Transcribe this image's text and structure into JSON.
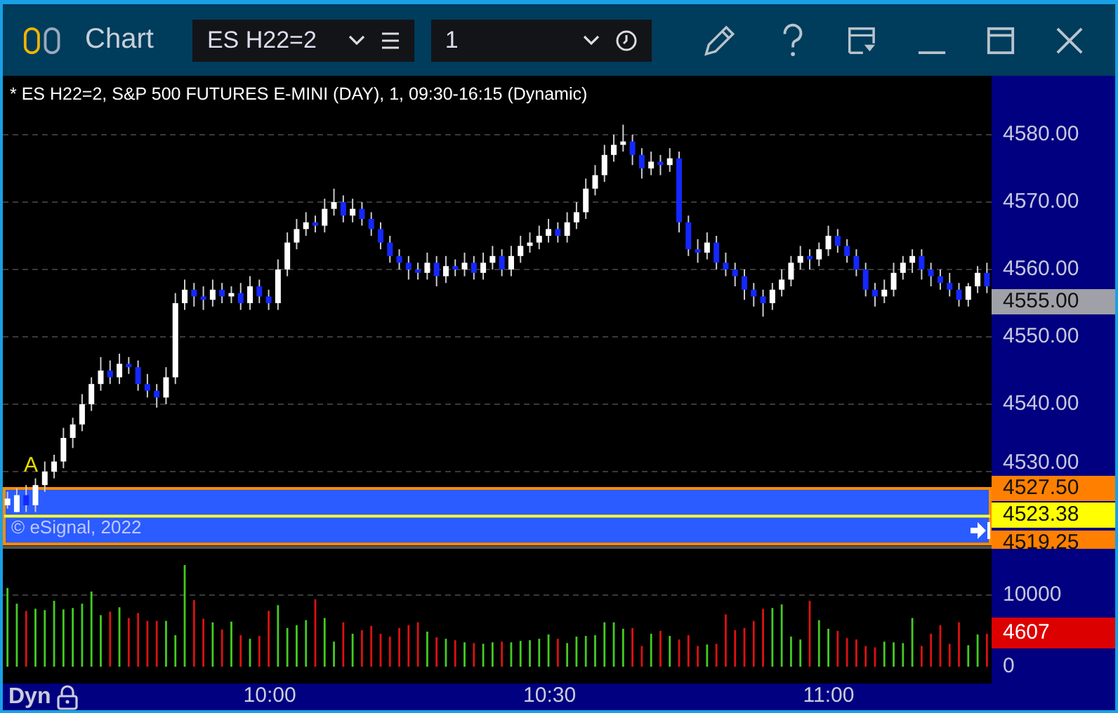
{
  "window": {
    "title": "Chart"
  },
  "symbol_field": {
    "value": "ES H22=2"
  },
  "interval_field": {
    "value": "1"
  },
  "chart_header": "* ES H22=2, S&P 500 FUTURES E-MINI (DAY), 1, 09:30-16:15 (Dynamic)",
  "price_chart": {
    "chart_data": {
      "type": "candlestick",
      "grid": true,
      "ylim": [
        4518.96,
        4588.75
      ],
      "bands": [
        {
          "axis": "y",
          "from": 4519.25,
          "to": 4527.5,
          "color": "#2b5cff"
        }
      ],
      "ref_lines": [
        {
          "axis": "y",
          "value": 4523.38,
          "color": "#ffff30"
        }
      ],
      "yticks": [
        {
          "value": 4580,
          "label": "4580.00"
        },
        {
          "value": 4570,
          "label": "4570.00"
        },
        {
          "value": 4560,
          "label": "4560.00"
        },
        {
          "value": 4550,
          "label": "4550.00"
        },
        {
          "value": 4540,
          "label": "4540.00"
        },
        {
          "value": 4530,
          "label": "4530.00"
        }
      ],
      "categories": [
        null,
        null,
        null,
        null,
        null,
        null,
        null,
        null,
        null,
        null,
        null,
        null,
        null,
        null,
        null,
        null,
        null,
        null,
        null,
        null,
        null,
        null,
        null,
        null,
        null,
        null,
        null,
        null,
        "10:00",
        null,
        null,
        null,
        null,
        null,
        null,
        null,
        null,
        null,
        null,
        null,
        null,
        null,
        null,
        null,
        null,
        null,
        null,
        null,
        null,
        null,
        null,
        null,
        null,
        null,
        null,
        null,
        null,
        null,
        "10:30",
        null,
        null,
        null,
        null,
        null,
        null,
        null,
        null,
        null,
        null,
        null,
        null,
        null,
        null,
        null,
        null,
        null,
        null,
        null,
        null,
        null,
        null,
        null,
        null,
        null,
        null,
        null,
        null,
        null,
        "11:00",
        null,
        null,
        null,
        null,
        null,
        null,
        null,
        null,
        null,
        null,
        null,
        null,
        null,
        null,
        null,
        null,
        null
      ],
      "ohlc": [
        [
          4525,
          4527,
          4524.5,
          4526
        ],
        [
          4524,
          4527.5,
          4524,
          4526.5
        ],
        [
          4526.5,
          4528,
          4524,
          4525
        ],
        [
          4525,
          4529,
          4524,
          4528
        ],
        [
          4528,
          4531.5,
          4527,
          4530
        ],
        [
          4530,
          4532.5,
          4529,
          4531.5
        ],
        [
          4531.5,
          4536.5,
          4530.5,
          4535
        ],
        [
          4535,
          4538,
          4533.5,
          4537
        ],
        [
          4537,
          4541.5,
          4536,
          4540
        ],
        [
          4540,
          4544,
          4539,
          4543
        ],
        [
          4543,
          4547,
          4542,
          4545
        ],
        [
          4545,
          4546.5,
          4543,
          4544
        ],
        [
          4544,
          4547.5,
          4543,
          4546
        ],
        [
          4546,
          4547,
          4544.5,
          4545.5
        ],
        [
          4545.5,
          4546.5,
          4542,
          4543
        ],
        [
          4543,
          4544.5,
          4541,
          4542
        ],
        [
          4542,
          4543,
          4539.5,
          4541
        ],
        [
          4541,
          4545.5,
          4540,
          4544
        ],
        [
          4544,
          4556.5,
          4543,
          4555
        ],
        [
          4555,
          4558.5,
          4554,
          4557
        ],
        [
          4557,
          4558,
          4554.5,
          4556
        ],
        [
          4556,
          4557.5,
          4554,
          4555.5
        ],
        [
          4555.5,
          4558.5,
          4554.5,
          4557
        ],
        [
          4557,
          4558,
          4555,
          4556
        ],
        [
          4556,
          4557.5,
          4555,
          4556.5
        ],
        [
          4556.5,
          4558,
          4554,
          4555
        ],
        [
          4555,
          4559,
          4554,
          4557.5
        ],
        [
          4557.5,
          4558.5,
          4555,
          4556
        ],
        [
          4556,
          4557,
          4554,
          4555
        ],
        [
          4555,
          4561.5,
          4554,
          4560
        ],
        [
          4560,
          4565.5,
          4559,
          4564
        ],
        [
          4564,
          4567.5,
          4563,
          4566
        ],
        [
          4566,
          4568.5,
          4565,
          4567
        ],
        [
          4567,
          4568,
          4565.5,
          4566.5
        ],
        [
          4566.5,
          4570.5,
          4565.5,
          4569
        ],
        [
          4569,
          4572,
          4568,
          4570
        ],
        [
          4570,
          4571,
          4567,
          4568
        ],
        [
          4568,
          4570.5,
          4567,
          4569
        ],
        [
          4569,
          4570,
          4566.5,
          4567.5
        ],
        [
          4567.5,
          4568.5,
          4565,
          4566
        ],
        [
          4566,
          4567,
          4563,
          4564
        ],
        [
          4564,
          4565,
          4561,
          4562
        ],
        [
          4562,
          4563,
          4560,
          4561
        ],
        [
          4561,
          4562,
          4558.5,
          4560
        ],
        [
          4560,
          4561,
          4558.5,
          4559.5
        ],
        [
          4559.5,
          4562.5,
          4558.5,
          4561
        ],
        [
          4561,
          4562,
          4557.5,
          4559
        ],
        [
          4559,
          4562,
          4558,
          4560.5
        ],
        [
          4560.5,
          4561.5,
          4559,
          4560
        ],
        [
          4560,
          4562.5,
          4559,
          4561
        ],
        [
          4561,
          4562,
          4558.5,
          4559.5
        ],
        [
          4559.5,
          4562.5,
          4558.5,
          4561
        ],
        [
          4561,
          4563.5,
          4560,
          4562
        ],
        [
          4562,
          4563,
          4559,
          4560
        ],
        [
          4560,
          4563.5,
          4559,
          4562
        ],
        [
          4562,
          4565,
          4561,
          4563.5
        ],
        [
          4563.5,
          4565.5,
          4562.5,
          4564
        ],
        [
          4564,
          4566.5,
          4563,
          4565
        ],
        [
          4565,
          4567.5,
          4564,
          4566
        ],
        [
          4566,
          4567,
          4564,
          4565
        ],
        [
          4565,
          4568.5,
          4564,
          4567
        ],
        [
          4567,
          4570,
          4566,
          4568.5
        ],
        [
          4568.5,
          4573.5,
          4567.5,
          4572
        ],
        [
          4572,
          4575.5,
          4571,
          4574
        ],
        [
          4574,
          4578.5,
          4573,
          4577
        ],
        [
          4577,
          4580,
          4576,
          4578.5
        ],
        [
          4578.5,
          4581.5,
          4577.5,
          4579
        ],
        [
          4579,
          4580,
          4575.5,
          4577
        ],
        [
          4577,
          4578,
          4573.5,
          4575
        ],
        [
          4575,
          4577.5,
          4574,
          4576
        ],
        [
          4576,
          4577,
          4574,
          4575.5
        ],
        [
          4575.5,
          4578,
          4574.5,
          4576.5
        ],
        [
          4576.5,
          4577.5,
          4565.5,
          4567
        ],
        [
          4567,
          4568,
          4562,
          4563
        ],
        [
          4563,
          4564.5,
          4561,
          4562.5
        ],
        [
          4562.5,
          4565.5,
          4561.5,
          4564
        ],
        [
          4564,
          4565,
          4560,
          4561
        ],
        [
          4561,
          4562.5,
          4559,
          4560
        ],
        [
          4560,
          4561,
          4557.5,
          4559
        ],
        [
          4559,
          4560,
          4555.5,
          4557
        ],
        [
          4557,
          4558,
          4554.5,
          4556
        ],
        [
          4556,
          4557,
          4553,
          4555
        ],
        [
          4555,
          4558,
          4554,
          4557
        ],
        [
          4557,
          4560,
          4556,
          4558.5
        ],
        [
          4558.5,
          4562,
          4557.5,
          4561
        ],
        [
          4561,
          4563.5,
          4560,
          4562
        ],
        [
          4562,
          4563,
          4560,
          4561.5
        ],
        [
          4561.5,
          4564,
          4560.5,
          4563
        ],
        [
          4563,
          4566.5,
          4562,
          4565
        ],
        [
          4565,
          4566,
          4562.5,
          4563.5
        ],
        [
          4563.5,
          4564.5,
          4561,
          4562
        ],
        [
          4562,
          4563,
          4559,
          4560
        ],
        [
          4560,
          4561,
          4556,
          4557
        ],
        [
          4557,
          4558,
          4554.5,
          4556
        ],
        [
          4556,
          4558.5,
          4555,
          4557
        ],
        [
          4557,
          4561,
          4556,
          4559.5
        ],
        [
          4559.5,
          4562,
          4558.5,
          4561
        ],
        [
          4561,
          4563,
          4559.5,
          4562
        ],
        [
          4562,
          4563,
          4558.5,
          4560
        ],
        [
          4560,
          4561,
          4557.5,
          4559
        ],
        [
          4559,
          4560,
          4557,
          4558
        ],
        [
          4558,
          4559.5,
          4556,
          4557
        ],
        [
          4557,
          4558,
          4554.5,
          4555.5
        ],
        [
          4555.5,
          4558,
          4554.5,
          4557.5
        ],
        [
          4557.5,
          4560.5,
          4556.5,
          4559.5
        ],
        [
          4559.5,
          4561,
          4556.5,
          4557.5
        ]
      ]
    }
  },
  "price_markers": [
    {
      "label": "4555.00",
      "color": "#a0a0a8"
    },
    {
      "label": "4527.50",
      "color": "#ff8000"
    },
    {
      "label": "4523.38",
      "color": "#ffff00"
    },
    {
      "label": "4519.25",
      "color": "#ff8000"
    }
  ],
  "bar_marker": "A",
  "copyright": "© eSignal, 2022",
  "volume_chart": {
    "chart_data": {
      "type": "bar",
      "grid": true,
      "ylim": [
        -2353,
        16471
      ],
      "yticks": [
        {
          "value": 10000,
          "label": "10000"
        },
        {
          "value": 0,
          "label": "0"
        }
      ],
      "values": [
        11000,
        8800,
        7800,
        8100,
        7900,
        9200,
        8000,
        8200,
        8800,
        10500,
        7200,
        7700,
        8300,
        6800,
        7500,
        6400,
        6400,
        6400,
        4400,
        14200,
        9300,
        6700,
        6200,
        5200,
        6300,
        4400,
        3900,
        4300,
        7800,
        8600,
        5400,
        5800,
        6500,
        9400,
        6800,
        3500,
        6200,
        4600,
        5100,
        5700,
        4600,
        4200,
        5400,
        5800,
        6200,
        4900,
        4100,
        3900,
        3700,
        3400,
        3300,
        3200,
        3400,
        3500,
        3400,
        3600,
        3700,
        3900,
        4500,
        3900,
        3300,
        4200,
        4300,
        4400,
        6200,
        6200,
        5300,
        5400,
        2900,
        4600,
        5000,
        4300,
        3800,
        4400,
        2900,
        3100,
        3200,
        7300,
        5100,
        5400,
        6400,
        8100,
        8200,
        8700,
        4200,
        3800,
        9200,
        6500,
        5300,
        5000,
        4000,
        3800,
        2900,
        2700,
        3500,
        3400,
        3300,
        6800,
        2900,
        4600,
        5800,
        3200,
        6200,
        3000,
        4500,
        4600
      ]
    },
    "current": {
      "label": "4607",
      "color": "#dd0000"
    }
  },
  "time_axis": {
    "mode": "Dyn",
    "locked": true
  }
}
